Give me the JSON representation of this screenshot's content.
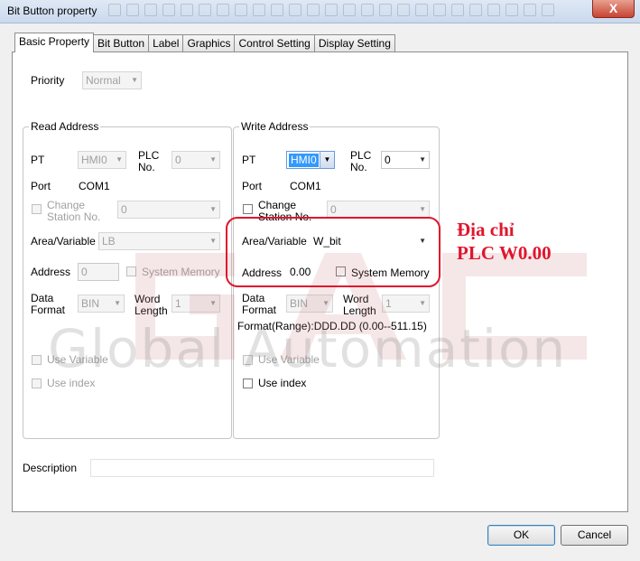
{
  "window": {
    "title": "Bit Button property",
    "close_glyph": "X"
  },
  "tabs": [
    {
      "label": "Basic Property"
    },
    {
      "label": "Bit Button"
    },
    {
      "label": "Label"
    },
    {
      "label": "Graphics"
    },
    {
      "label": "Control Setting"
    },
    {
      "label": "Display Setting"
    }
  ],
  "priority": {
    "label": "Priority",
    "value": "Normal"
  },
  "read": {
    "title": "Read Address",
    "pt_label": "PT",
    "pt_value": "HMI0",
    "plc_label": "PLC\nNo.",
    "plc_value": "0",
    "port_label": "Port",
    "port_value": "COM1",
    "change_label": "Change\nStation No.",
    "change_value": "0",
    "area_label": "Area/Variable",
    "area_value": "LB",
    "address_label": "Address",
    "address_value": "0",
    "sysmem_label": "System Memory",
    "format_label": "Data\nFormat",
    "format_value": "BIN",
    "wordlen_label": "Word\nLength",
    "wordlen_value": "1",
    "usevar_label": "Use Variable",
    "useindex_label": "Use index"
  },
  "write": {
    "title": "Write Address",
    "pt_label": "PT",
    "pt_value": "HMI0",
    "plc_label": "PLC\nNo.",
    "plc_value": "0",
    "port_label": "Port",
    "port_value": "COM1",
    "change_label": "Change\nStation No.",
    "change_value": "0",
    "area_label": "Area/Variable",
    "area_value": "W_bit",
    "address_label": "Address",
    "address_value": "0.00",
    "sysmem_label": "System Memory",
    "format_label": "Data\nFormat",
    "format_value": "BIN",
    "wordlen_label": "Word\nLength",
    "wordlen_value": "1",
    "range_text": "Format(Range):DDD.DD (0.00--511.15)",
    "usevar_label": "Use Variable",
    "useindex_label": "Use index"
  },
  "description": {
    "label": "Description",
    "value": ""
  },
  "annotation": {
    "line1": "Địa chỉ",
    "line2": "PLC W0.00",
    "color": "#e0152d"
  },
  "watermark": {
    "text": "Global Automation",
    "logo_text": "GAC"
  },
  "buttons": {
    "ok": "OK",
    "cancel": "Cancel"
  }
}
